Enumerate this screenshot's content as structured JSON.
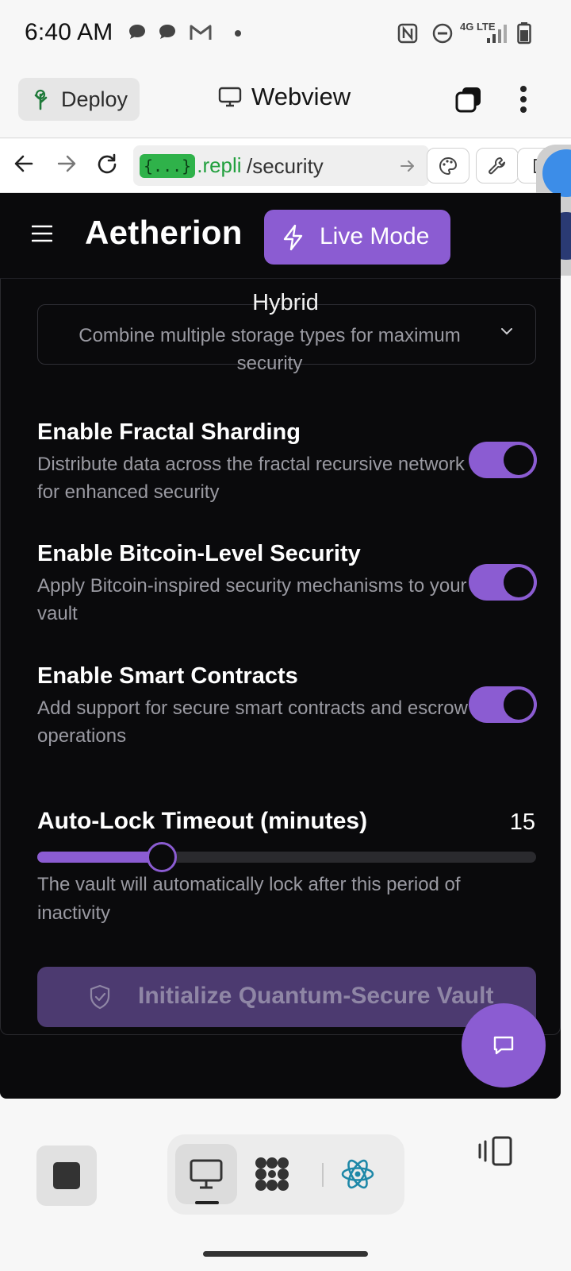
{
  "status_bar": {
    "time": "6:40 AM",
    "network": "4G LTE"
  },
  "replit_bar": {
    "deploy_label": "Deploy",
    "view_title": "Webview"
  },
  "url_bar": {
    "host_pill": "{...}",
    "host_text": ".repli",
    "path": "/security"
  },
  "app": {
    "title": "Aetherion",
    "live_mode_label": "Live Mode",
    "storage_select": {
      "value": "Hybrid",
      "description": "Combine multiple storage types for maximum security"
    },
    "settings": [
      {
        "title": "Enable Fractal Sharding",
        "description": "Distribute data across the fractal recursive network for enhanced security",
        "enabled": true
      },
      {
        "title": "Enable Bitcoin-Level Security",
        "description": "Apply Bitcoin-inspired security mechanisms to your vault",
        "enabled": true
      },
      {
        "title": "Enable Smart Contracts",
        "description": "Add support for secure smart contracts and escrow operations",
        "enabled": true
      }
    ],
    "auto_lock": {
      "label": "Auto-Lock Timeout (minutes)",
      "value": "15",
      "fill_fraction": 0.25,
      "help": "The vault will automatically lock after this period of inactivity"
    },
    "init_button_label": "Initialize Quantum-Secure Vault"
  },
  "colors": {
    "accent": "#8b5cd2",
    "app_background": "#0a0a0c",
    "muted_text": "#9a9aa2",
    "disabled_button": "#4c3a70"
  },
  "icons": {
    "deploy": "deploy-tree-icon",
    "webview": "monitor-icon",
    "live_mode": "lightning-bolt-icon",
    "init_button": "shield-check-icon",
    "chat": "chat-bubble-icon",
    "bottom_toolbar": [
      "stop-icon",
      "monitor-icon",
      "dots-pattern-icon",
      "react-atom-icon",
      "device-switch-icon"
    ]
  }
}
